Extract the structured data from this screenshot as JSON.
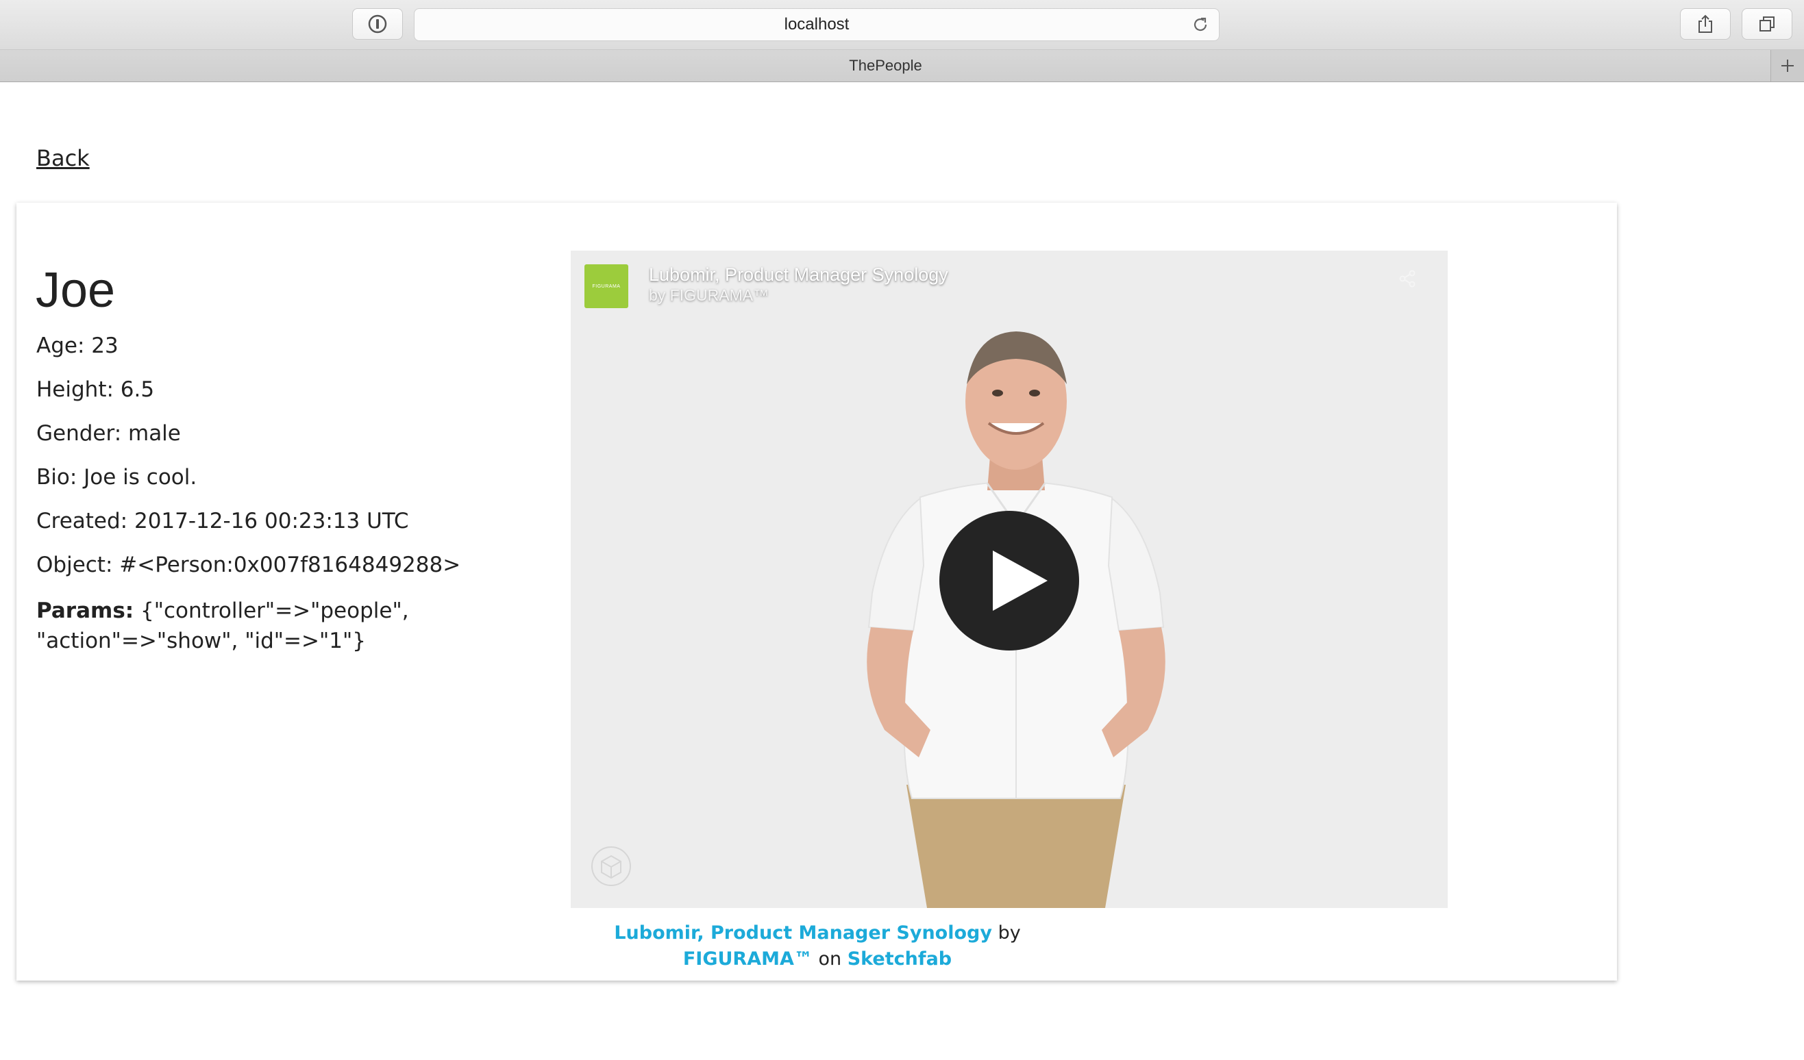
{
  "browser": {
    "url": "localhost",
    "tab_title": "ThePeople",
    "icons": [
      "password-icon",
      "reload-icon",
      "share-icon",
      "tabs-overview-icon",
      "new-tab-icon"
    ]
  },
  "page": {
    "back_link": "Back",
    "person": {
      "name": "Joe",
      "age": "Age: 23",
      "height": "Height: 6.5",
      "gender": "Gender: male",
      "bio": "Bio: Joe is cool.",
      "created": "Created: 2017-12-16 00:23:13 UTC",
      "object": "Object: #<Person:0x007f8164849288>",
      "params_label": "Params:",
      "params_value": " {\"controller\"=>\"people\", \"action\"=>\"show\", \"id\"=>\"1\"}"
    },
    "embed": {
      "title": "Lubomir, Product Manager Synology",
      "byline": "by FIGURAMA™",
      "thumb_text": "FIGURAMA",
      "icons": [
        "share-icon",
        "3d-cube-icon",
        "play-icon"
      ],
      "credit": {
        "model_link": "Lubomir, Product Manager Synology",
        "by": "by",
        "author_link": "FIGURAMA™",
        "on": "on",
        "platform_link": "Sketchfab"
      }
    }
  },
  "colors": {
    "link_blue": "#1caad9",
    "thumb_green": "#9ccc3c",
    "viewer_bg": "#ededed"
  }
}
